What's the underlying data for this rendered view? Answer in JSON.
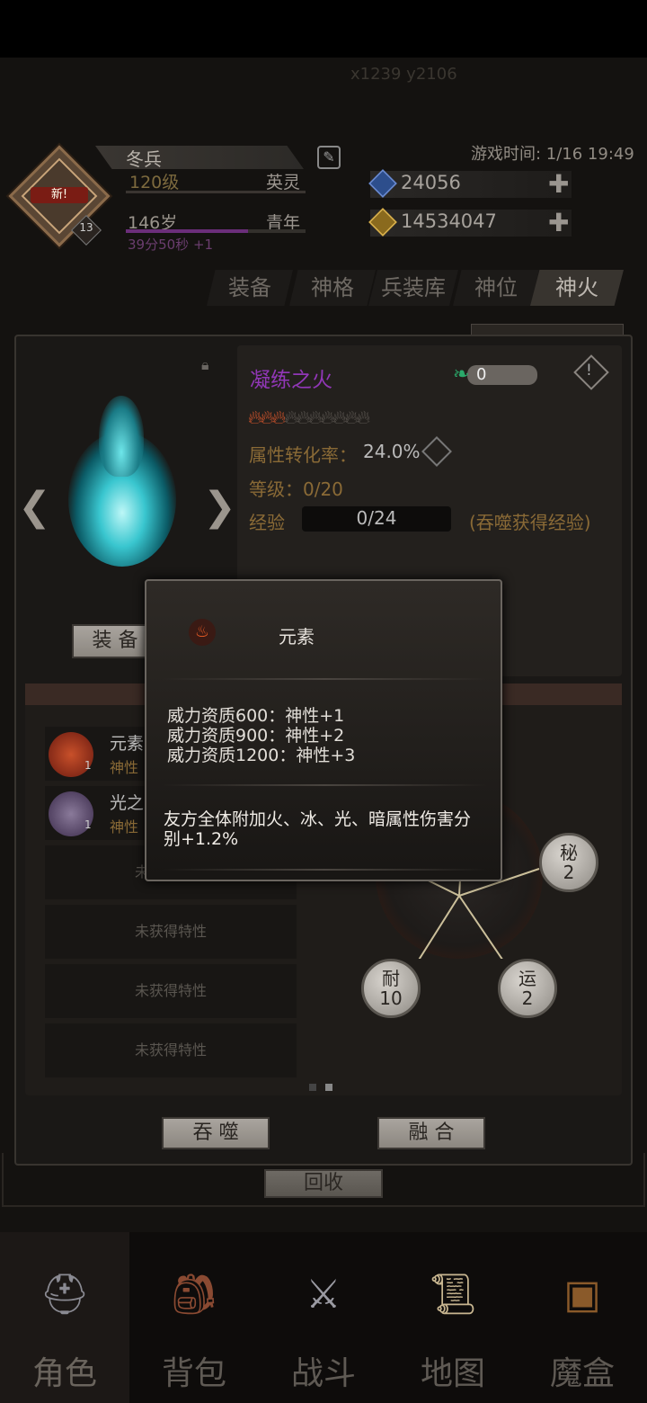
{
  "header": {
    "coords": "x1239 y2106",
    "name": "冬兵",
    "level": "120级",
    "rank": "英灵",
    "age": "146岁",
    "stage": "青年",
    "timer": "39分50秒 +1",
    "game_time": "游戏时间: 1/16 19:49",
    "avatar_new": "新!",
    "avatar_badge": "13",
    "currencies": [
      {
        "icon": "blue-gem-icon",
        "value": "24056"
      },
      {
        "icon": "gold-gem-icon",
        "value": "14534047"
      }
    ]
  },
  "tabs": [
    "装备",
    "神格",
    "兵装库",
    "神位",
    "神火"
  ],
  "active_tab": "神火",
  "fire": {
    "name": "凝练之火",
    "spirit": "0",
    "stars_filled": 3,
    "stars_total": 10,
    "rate_label": "属性转化率：",
    "rate_value": "24.0%",
    "level": "等级：0/20",
    "exp_label": "经验",
    "exp_value": "0/24",
    "exp_hint": "(吞噬获得经验)",
    "equip_label": "装 备"
  },
  "traits": [
    {
      "name": "元素",
      "sub": "神性",
      "count": "1"
    },
    {
      "name": "光之",
      "sub": "神性",
      "count": "1"
    },
    {
      "empty": "未获得特性"
    },
    {
      "empty": "未获得特性"
    },
    {
      "empty": "未获得特性"
    },
    {
      "empty": "未获得特性"
    }
  ],
  "nodes": [
    {
      "name": "秘",
      "value": "2"
    },
    {
      "name": "耐",
      "value": "10"
    },
    {
      "name": "运",
      "value": "2"
    }
  ],
  "actions": {
    "devour": "吞 噬",
    "fuse": "融 合",
    "recycle": "回收"
  },
  "popup": {
    "title": "元素",
    "lines": [
      "威力资质600：神性+1",
      "威力资质900：神性+2",
      "威力资质1200：神性+3"
    ],
    "desc": "友方全体附加火、冰、光、暗属性伤害分别+1.2%"
  },
  "nav": [
    {
      "label": "角色",
      "icon": "helmet-icon",
      "active": true
    },
    {
      "label": "背包",
      "icon": "backpack-icon",
      "active": false
    },
    {
      "label": "战斗",
      "icon": "sword-shield-icon",
      "active": false
    },
    {
      "label": "地图",
      "icon": "scroll-map-icon",
      "active": false
    },
    {
      "label": "魔盒",
      "icon": "magic-box-icon",
      "active": false
    }
  ]
}
